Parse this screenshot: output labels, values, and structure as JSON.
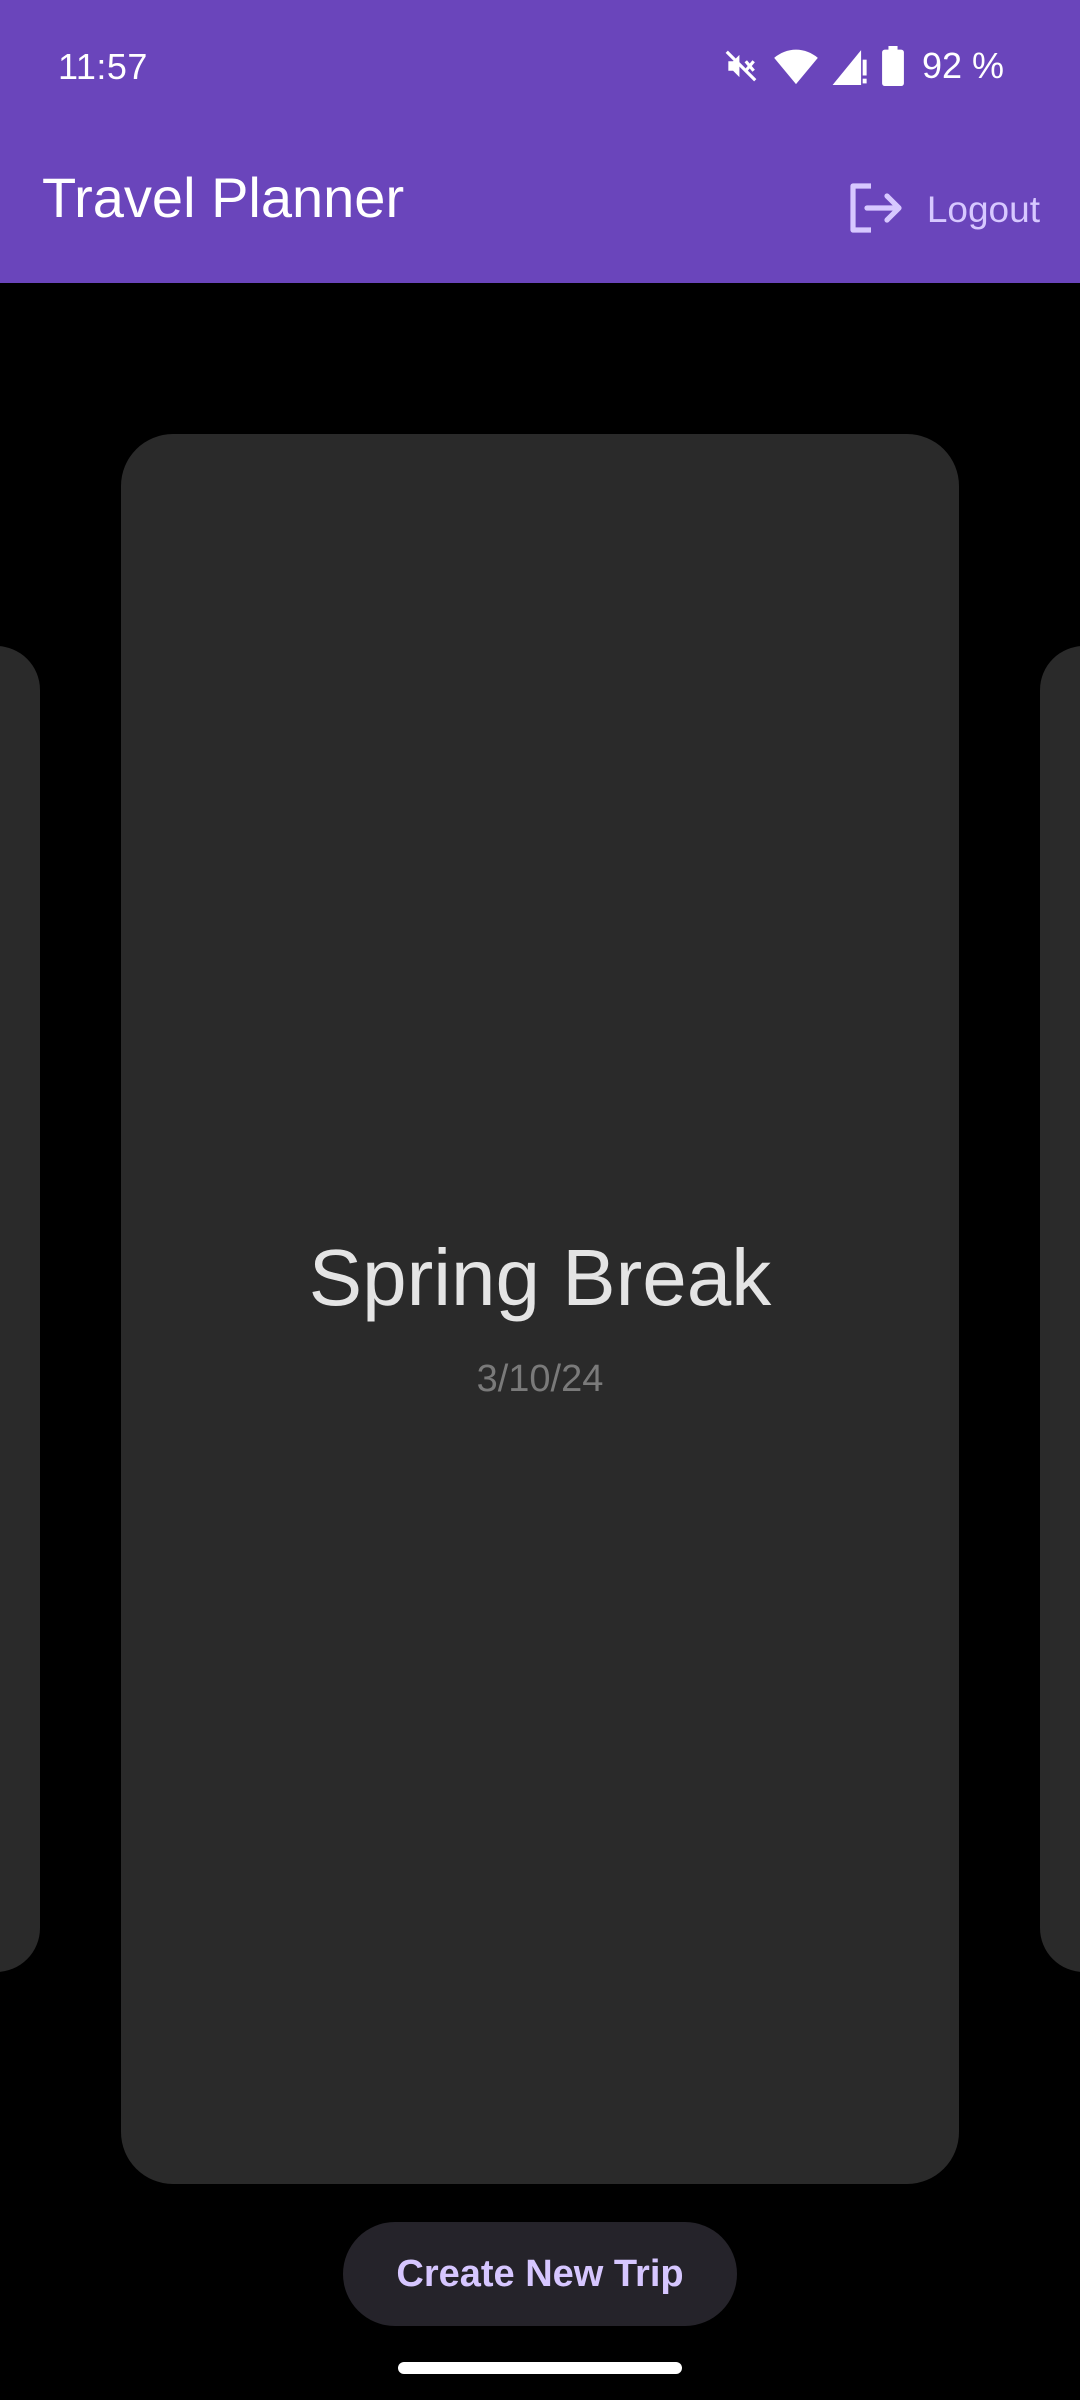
{
  "status_bar": {
    "time": "11:57",
    "battery_percent": "92 %",
    "icons": [
      "mute-icon",
      "wifi-icon",
      "signal-icon",
      "battery-icon"
    ]
  },
  "app_bar": {
    "title": "Travel Planner",
    "logout_label": "Logout",
    "background_color": "#6a45bb",
    "accent_color": "#d7c8ff"
  },
  "trips": {
    "current": {
      "title": "Spring Break",
      "date": "3/10/24"
    }
  },
  "actions": {
    "create_label": "Create New Trip"
  }
}
